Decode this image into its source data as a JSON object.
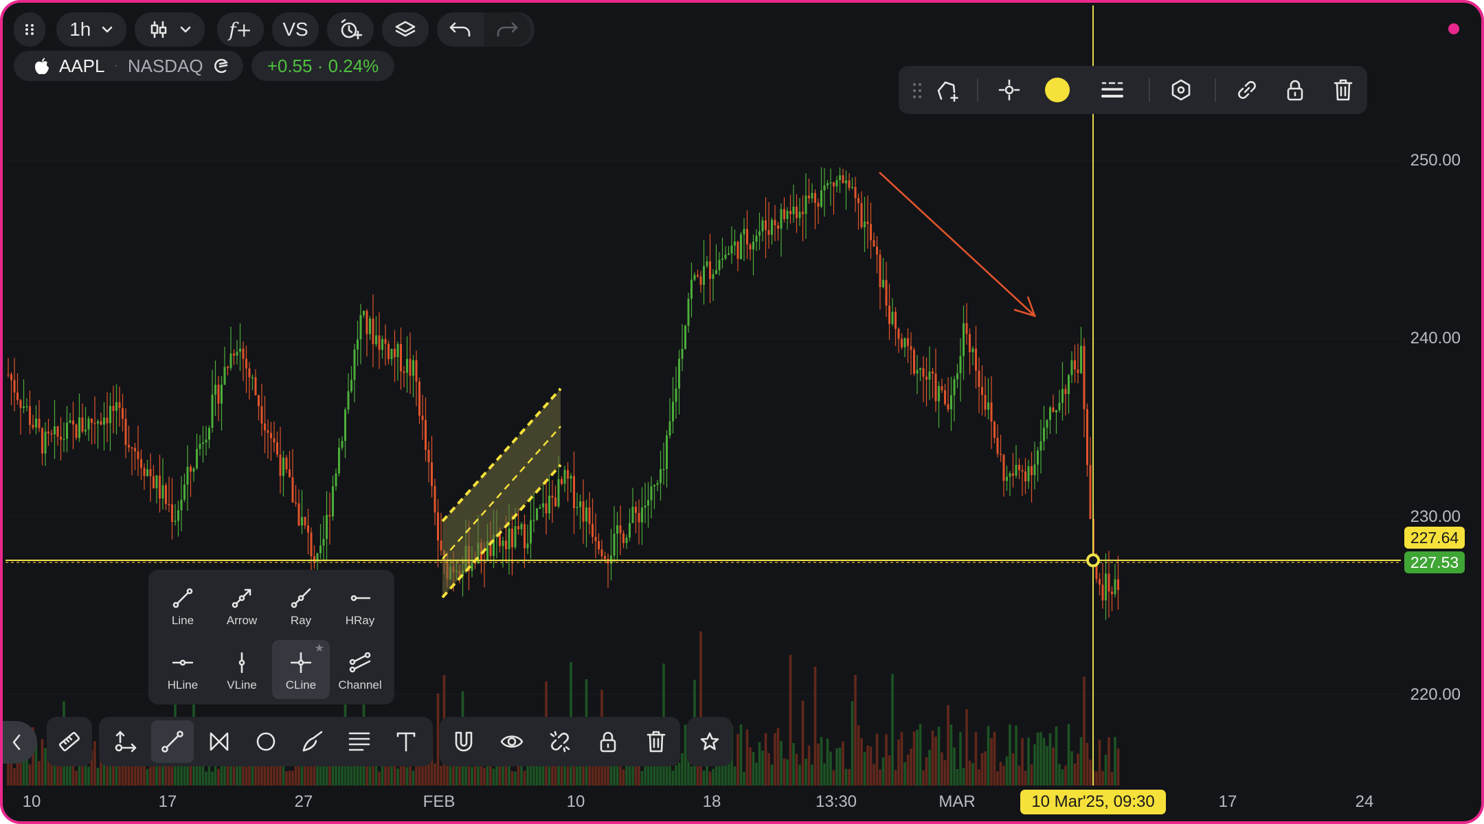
{
  "toolbar_top": {
    "interval": "1h",
    "compare_label": "VS",
    "indicator_glyph": "f+"
  },
  "symbol": {
    "ticker": "AAPL",
    "exchange": "NASDAQ",
    "change": "+0.55 · 0.24%"
  },
  "price_axis": {
    "labels": [
      "250.00",
      "240.00",
      "230.00",
      "220.00"
    ],
    "crosshair_price": "227.64",
    "last_price": "227.53"
  },
  "time_axis": {
    "labels": [
      "10",
      "17",
      "27",
      "FEB",
      "10",
      "18",
      "13:30",
      "MAR",
      "17",
      "24"
    ],
    "crosshair_time": "10 Mar'25, 09:30"
  },
  "line_tools_menu": {
    "items": [
      "Line",
      "Arrow",
      "Ray",
      "HRay",
      "HLine",
      "VLine",
      "CLine",
      "Channel"
    ]
  },
  "drawing_toolbar": {
    "color": "#f5e13a"
  },
  "colors": {
    "up": "#4cae3a",
    "down": "#e0542b",
    "accent": "#f0e44a",
    "last_price_bg": "#3fa535",
    "border": "#e8288c"
  }
}
